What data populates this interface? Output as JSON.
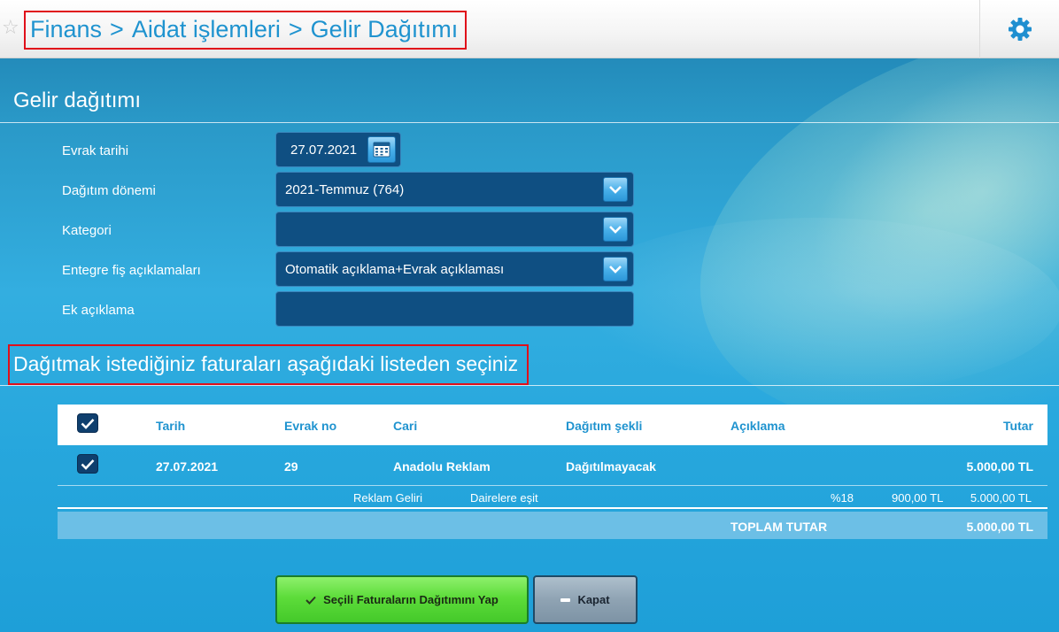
{
  "breadcrumb": {
    "items": [
      "Finans",
      "Aidat işlemleri",
      "Gelir Dağıtımı"
    ],
    "separator": ">"
  },
  "section1": {
    "title": "Gelir dağıtımı"
  },
  "form": {
    "evrak_tarihi": {
      "label": "Evrak tarihi",
      "value": "27.07.2021"
    },
    "dagitim_donemi": {
      "label": "Dağıtım dönemi",
      "value": "2021-Temmuz (764)"
    },
    "kategori": {
      "label": "Kategori",
      "value": ""
    },
    "entegre_fis": {
      "label": "Entegre fiş açıklamaları",
      "value": "Otomatik açıklama+Evrak açıklaması"
    },
    "ek_aciklama": {
      "label": "Ek açıklama",
      "value": ""
    }
  },
  "section2": {
    "title": "Dağıtmak istediğiniz faturaları aşağıdaki listeden seçiniz"
  },
  "table": {
    "headers": {
      "tarih": "Tarih",
      "evrak_no": "Evrak no",
      "cari": "Cari",
      "dagitim_sekli": "Dağıtım şekli",
      "aciklama": "Açıklama",
      "tutar": "Tutar"
    },
    "header_checked": true,
    "rows": [
      {
        "checked": true,
        "tarih": "27.07.2021",
        "evrak_no": "29",
        "cari": "Anadolu Reklam",
        "dagitim_sekli": "Dağıtılmayacak",
        "aciklama": "",
        "tutar": "5.000,00 TL"
      }
    ],
    "detail": {
      "gelir": "Reklam Geliri",
      "dagitim": "Dairelere eşit",
      "kdv": "%18",
      "kdv_tutar": "900,00 TL",
      "tutar": "5.000,00 TL"
    },
    "total": {
      "label": "TOPLAM TUTAR",
      "value": "5.000,00 TL"
    }
  },
  "buttons": {
    "apply": "Seçili Faturaların Dağıtımını Yap",
    "close": "Kapat"
  },
  "colors": {
    "accent": "#1f93cf",
    "apply_green": "#5ddc3a",
    "highlight_red": "#e0101a"
  }
}
